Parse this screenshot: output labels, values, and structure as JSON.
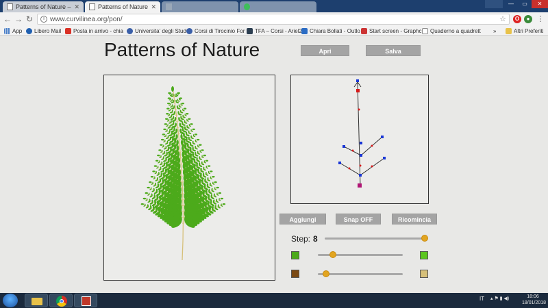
{
  "browser": {
    "tabs": [
      {
        "title": "Patterns of Nature – Cur",
        "active": false
      },
      {
        "title": "Patterns of Nature - Cre",
        "active": true
      },
      {
        "title": "",
        "active": false
      },
      {
        "title": "",
        "active": false
      }
    ],
    "url": "www.curvilinea.org/pon/",
    "bookmarks": [
      {
        "label": "App",
        "color": "#4a7fc8"
      },
      {
        "label": "Libero Mail",
        "color": "#1f5fb0"
      },
      {
        "label": "Posta in arrivo - chia",
        "color": "#d93025"
      },
      {
        "label": "Universita' degli Stud",
        "color": "#3a5fa8"
      },
      {
        "label": "Corsi di Tirocinio For",
        "color": "#3a5fa8"
      },
      {
        "label": "TFA – Corsi - Ariel2",
        "color": "#2c3e50"
      },
      {
        "label": "Chiara Bollati - Outlo",
        "color": "#2b6cc4"
      },
      {
        "label": "Start screen - Graphc",
        "color": "#cc3333"
      },
      {
        "label": "Quaderno a quadrett",
        "color": "#8a8a8a"
      }
    ],
    "bookmarks_overflow": "»",
    "other_bookmarks": "Altri Preferiti"
  },
  "app": {
    "title": "Patterns of Nature",
    "buttons": {
      "open": "Apri",
      "save": "Salva",
      "add": "Aggiungi",
      "snap": "Snap OFF",
      "restart": "Ricomincia"
    },
    "step": {
      "label": "Step:",
      "value": "8",
      "fraction": 1.0
    },
    "color_sliders": [
      {
        "left_color": "#4caa1b",
        "right_color": "#5bc61f",
        "fraction": 0.18
      },
      {
        "left_color": "#7b4a14",
        "right_color": "#d6c07a",
        "fraction": 0.1
      }
    ],
    "accent": "#e2a520"
  },
  "taskbar": {
    "language": "IT",
    "time": "18:06",
    "date": "18/01/2018"
  }
}
